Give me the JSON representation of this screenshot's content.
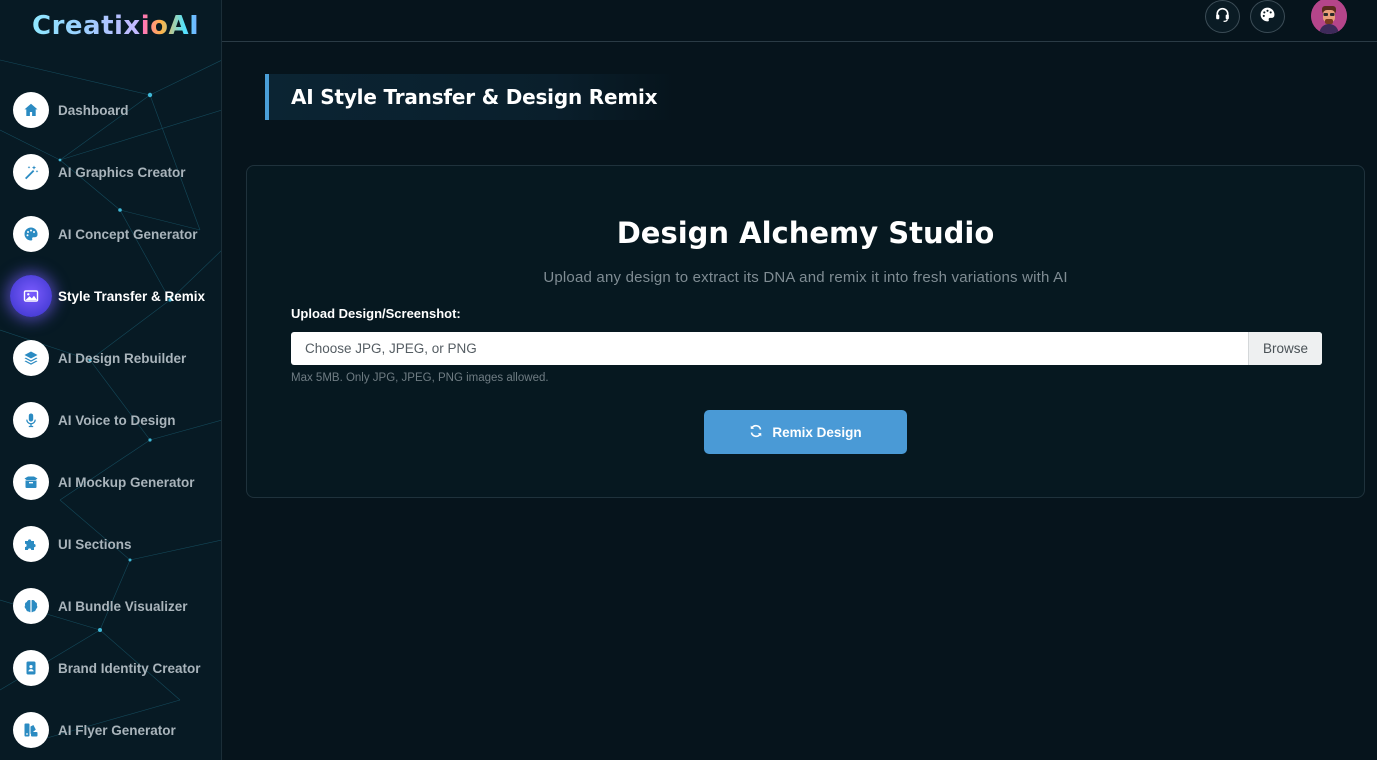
{
  "brand": {
    "logo_main": "Creatix",
    "logo_accent": "ioAI"
  },
  "colors": {
    "accent": "#4a9ad6",
    "active_nav": "#5b47e8",
    "background": "#06141c"
  },
  "sidebar": {
    "items": [
      {
        "label": "Dashboard",
        "icon": "home-icon"
      },
      {
        "label": "AI Graphics Creator",
        "icon": "magic-wand-icon"
      },
      {
        "label": "AI Concept Generator",
        "icon": "palette-icon"
      },
      {
        "label": "Style Transfer & Remix",
        "icon": "image-icon",
        "active": true
      },
      {
        "label": "AI Design Rebuilder",
        "icon": "layers-icon"
      },
      {
        "label": "AI Voice to Design",
        "icon": "microphone-icon"
      },
      {
        "label": "AI Mockup Generator",
        "icon": "box-icon"
      },
      {
        "label": "UI Sections",
        "icon": "puzzle-icon"
      },
      {
        "label": "AI Bundle Visualizer",
        "icon": "brain-icon"
      },
      {
        "label": "Brand Identity Creator",
        "icon": "id-card-icon"
      },
      {
        "label": "AI Flyer Generator",
        "icon": "swatch-icon"
      }
    ]
  },
  "header": {
    "support_icon": "headset-icon",
    "theme_icon": "palette-icon",
    "avatar": "user-avatar"
  },
  "page": {
    "title": "AI Style Transfer & Design Remix"
  },
  "card": {
    "title": "Design Alchemy Studio",
    "subtitle": "Upload any design to extract its DNA and remix it into fresh variations with AI",
    "upload_label": "Upload Design/Screenshot:",
    "file_placeholder": "Choose JPG, JPEG, or PNG",
    "browse_label": "Browse",
    "help_text": "Max 5MB. Only JPG, JPEG, PNG images allowed.",
    "button_label": "Remix Design",
    "button_icon": "sync-icon"
  }
}
